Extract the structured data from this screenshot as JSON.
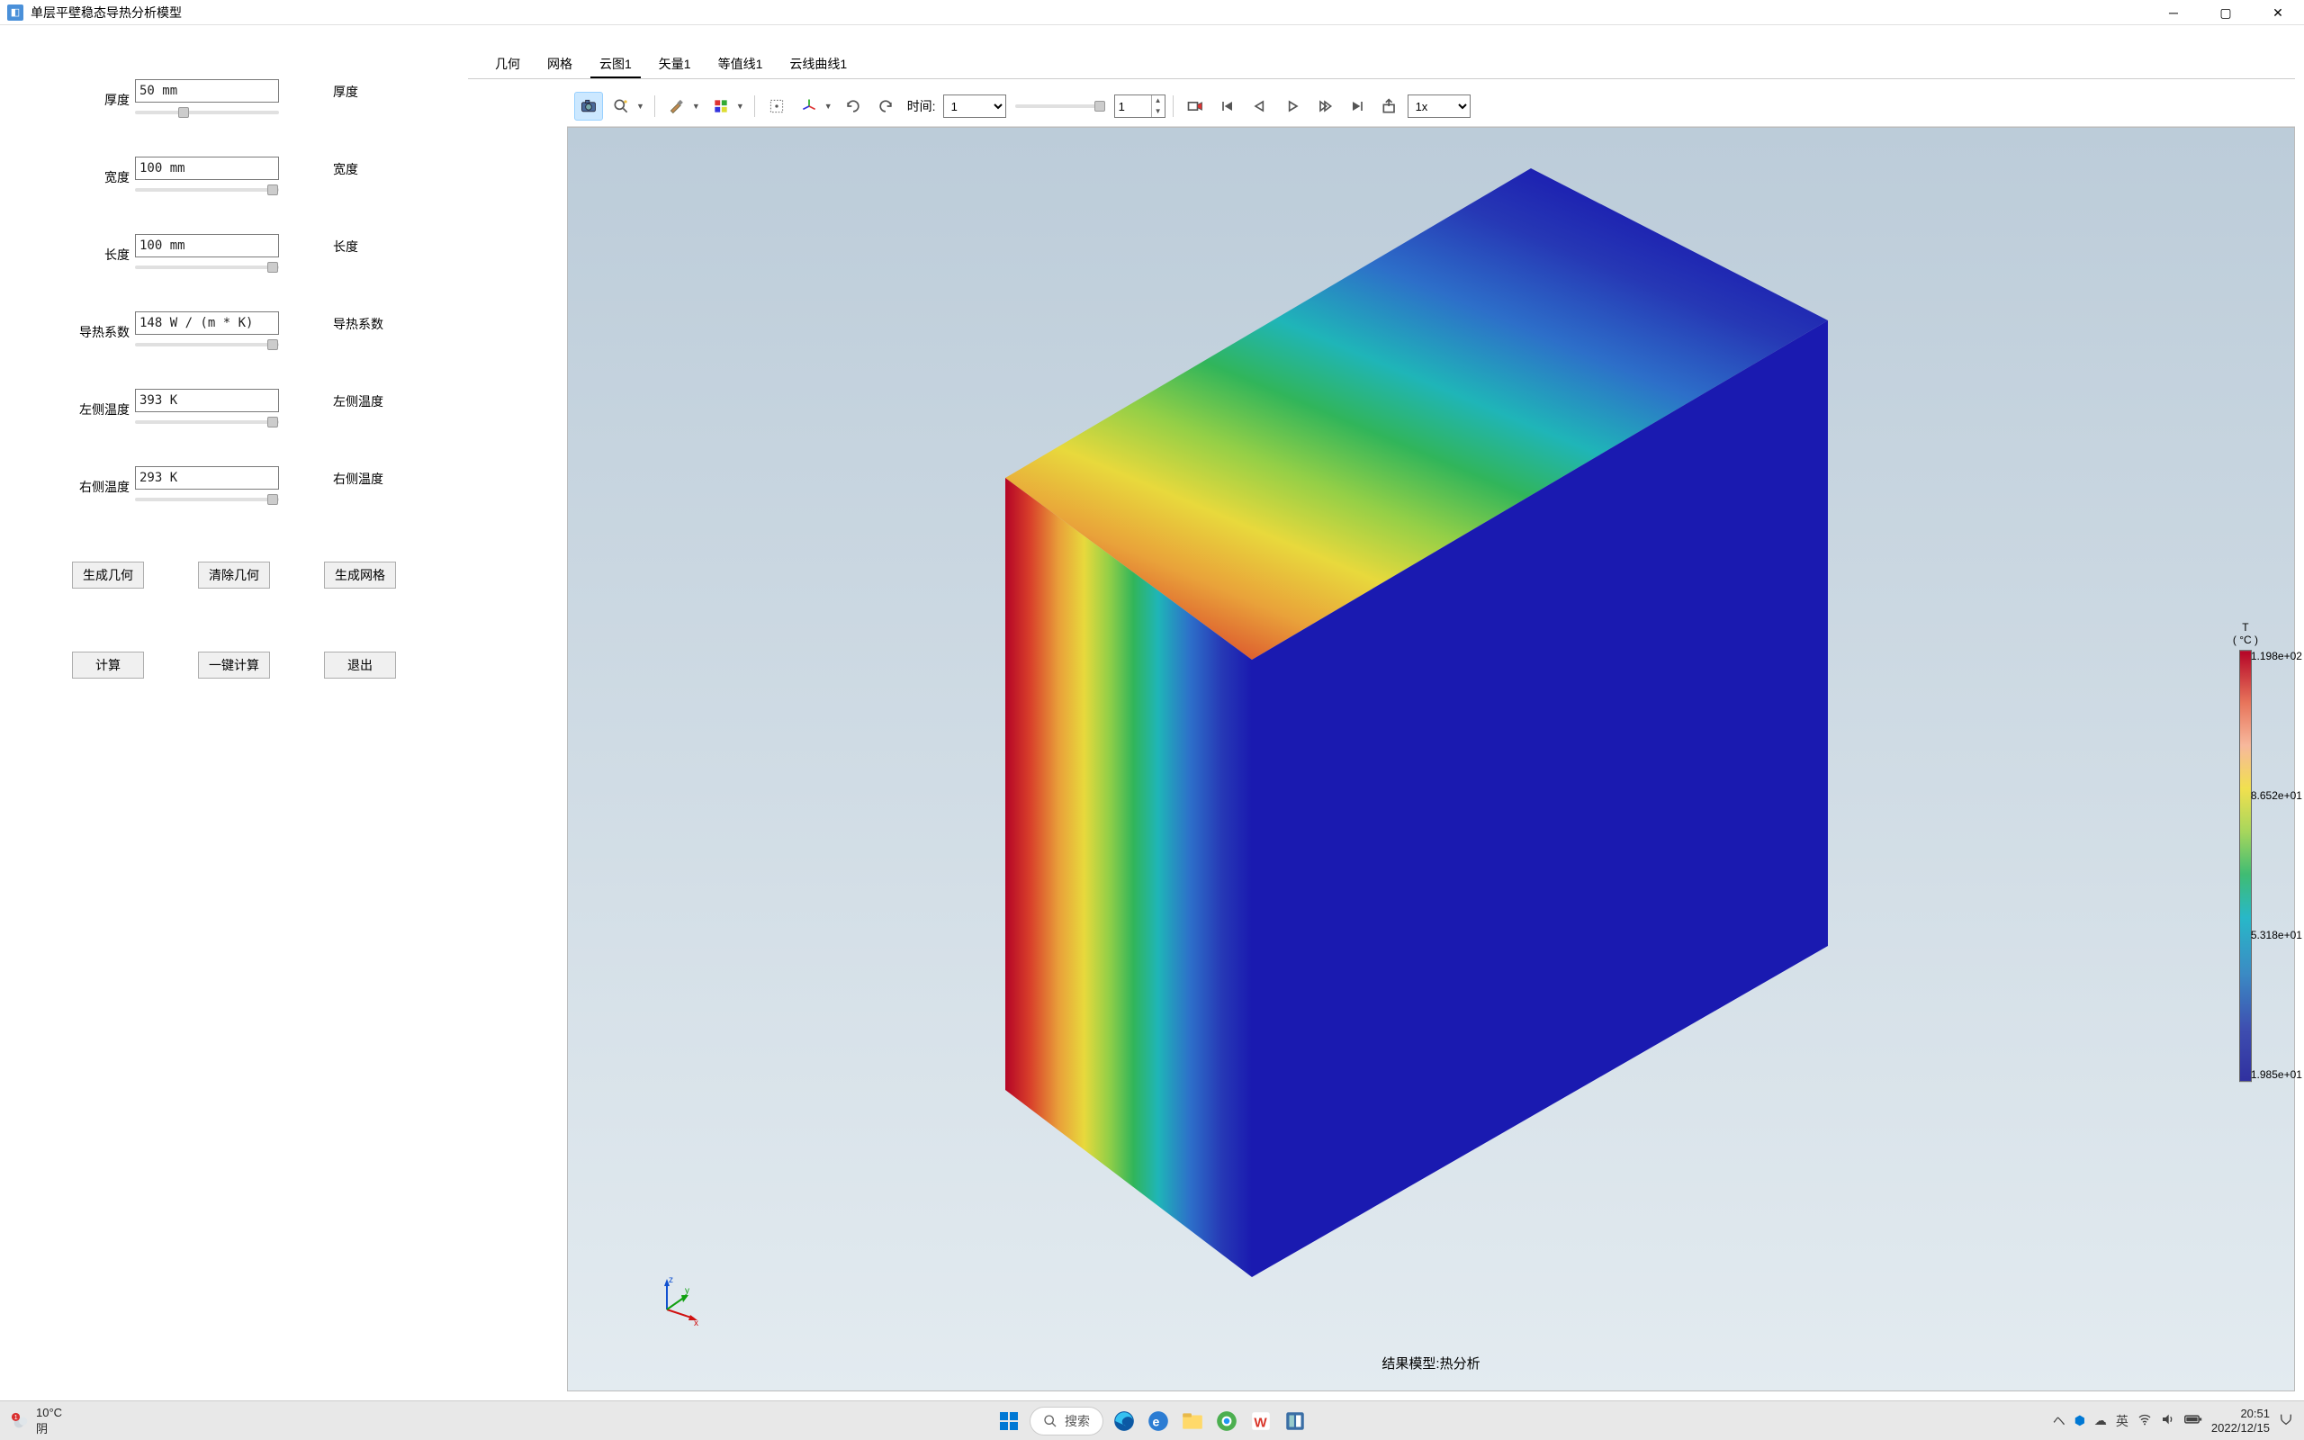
{
  "window": {
    "title": "单层平壁稳态导热分析模型"
  },
  "params": {
    "rows": [
      {
        "label_left": "厚度",
        "value": "50 mm",
        "label_right": "厚度",
        "thumb_pct": 30
      },
      {
        "label_left": "宽度",
        "value": "100 mm",
        "label_right": "宽度",
        "thumb_pct": 92
      },
      {
        "label_left": "长度",
        "value": "100 mm",
        "label_right": "长度",
        "thumb_pct": 92
      },
      {
        "label_left": "导热系数",
        "value": "148 W / (m * K)",
        "label_right": "导热系数",
        "thumb_pct": 92
      },
      {
        "label_left": "左侧温度",
        "value": "393 K",
        "label_right": "左侧温度",
        "thumb_pct": 92
      },
      {
        "label_left": "右侧温度",
        "value": "293 K",
        "label_right": "右侧温度",
        "thumb_pct": 92
      }
    ],
    "buttons_row1": [
      "生成几何",
      "清除几何",
      "生成网格"
    ],
    "buttons_row2": [
      "计算",
      "一键计算",
      "退出"
    ]
  },
  "tabs": {
    "items": [
      "几何",
      "网格",
      "云图1",
      "矢量1",
      "等值线1",
      "云线曲线1"
    ],
    "active_index": 2
  },
  "toolbar": {
    "time_label": "时间:",
    "time_value": "1",
    "frame_value": "1",
    "speed_value": "1x"
  },
  "viewport": {
    "result_title": "结果模型:热分析",
    "colorbar": {
      "title_line1": "T",
      "title_line2": "( °C )",
      "labels": [
        "1.198e+02",
        "8.652e+01",
        "5.318e+01",
        "1.985e+01"
      ]
    }
  },
  "taskbar": {
    "weather_temp": "10°C",
    "weather_desc": "阴",
    "search_placeholder": "搜索",
    "ime": "英",
    "time": "20:51",
    "date": "2022/12/15"
  }
}
